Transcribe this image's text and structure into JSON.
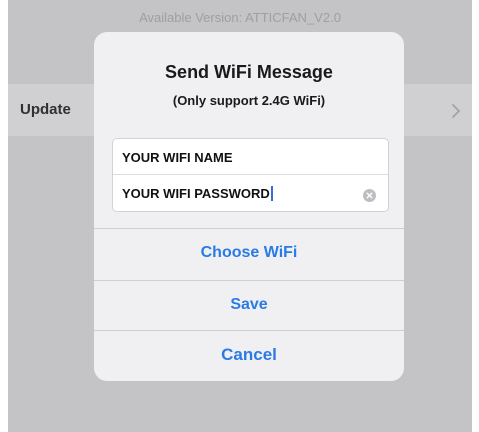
{
  "background": {
    "available_version": "Available Version: ATTICFAN_V2.0",
    "update_row": {
      "label": "Update",
      "chevron_icon": "chevron-right-icon"
    }
  },
  "dialog": {
    "title": "Send WiFi Message",
    "subtitle": "(Only support 2.4G WiFi)",
    "wifi_name_value": "YOUR WIFI NAME",
    "wifi_password_value": "YOUR WIFI PASSWORD",
    "clear_icon": "clear-circle-icon",
    "actions": {
      "choose_wifi": "Choose WiFi",
      "save": "Save",
      "cancel": "Cancel"
    }
  },
  "colors": {
    "dimmed_background": "#c4c3c6",
    "dialog_background": "#f0f0f2",
    "accent_blue": "#2a7be4"
  }
}
